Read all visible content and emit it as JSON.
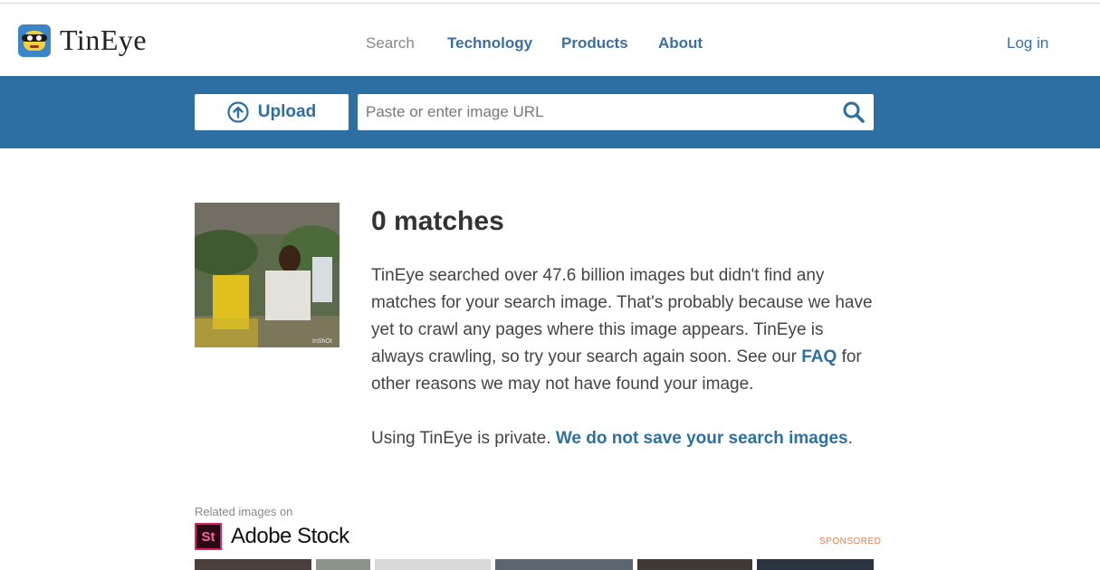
{
  "header": {
    "logo_text": "TinEye",
    "nav": [
      {
        "label": "Search",
        "active": true
      },
      {
        "label": "Technology",
        "active": false
      },
      {
        "label": "Products",
        "active": false
      },
      {
        "label": "About",
        "active": false
      }
    ],
    "login_label": "Log in"
  },
  "search": {
    "upload_label": "Upload",
    "url_placeholder": "Paste or enter image URL",
    "url_value": ""
  },
  "result": {
    "thumbnail_watermark": "InShOt",
    "title": "0 matches",
    "text_before_link": "TinEye searched over 47.6 billion images but didn't find any matches for your search image. That's probably because we have yet to crawl any pages where this image appears. TinEye is always crawling, so try your search again soon. See our ",
    "faq_link": "FAQ",
    "text_after_link": " for other reasons we may not have found your image.",
    "privacy_text": "Using TinEye is private. ",
    "privacy_link": "We do not save your search images",
    "privacy_end": "."
  },
  "related": {
    "label": "Related images on",
    "brand_badge": "St",
    "brand_name": "Adobe Stock",
    "sponsored_label": "SPONSORED"
  },
  "colors": {
    "brand_blue": "#2d6fa3",
    "link_blue": "#3a6fa6",
    "sponsored_orange": "#e87b4c",
    "adobe_pink": "#e0205e"
  }
}
